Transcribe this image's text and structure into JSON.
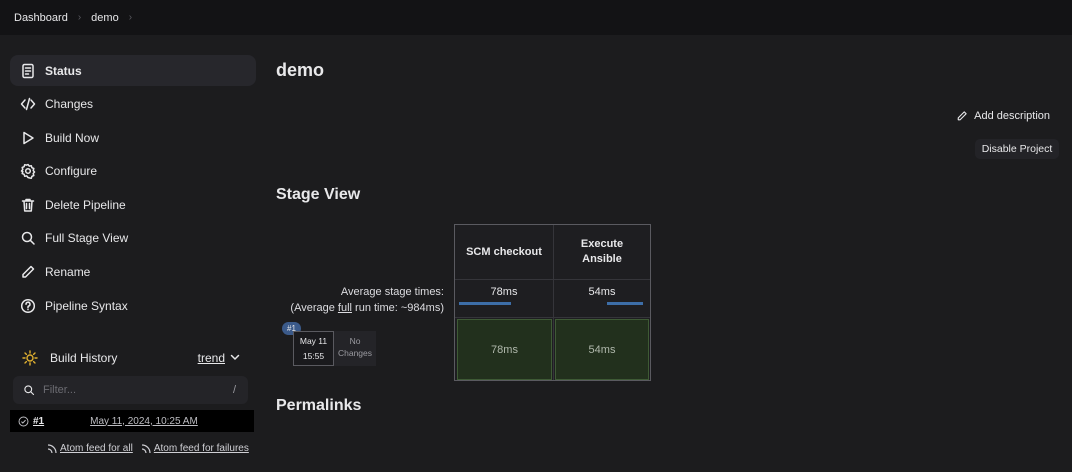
{
  "breadcrumb": {
    "items": [
      "Dashboard",
      "demo"
    ]
  },
  "sidebar": {
    "items": [
      {
        "label": "Status",
        "icon": "status-icon"
      },
      {
        "label": "Changes",
        "icon": "code-icon"
      },
      {
        "label": "Build Now",
        "icon": "play-icon"
      },
      {
        "label": "Configure",
        "icon": "gear-icon"
      },
      {
        "label": "Delete Pipeline",
        "icon": "trash-icon"
      },
      {
        "label": "Full Stage View",
        "icon": "search-icon"
      },
      {
        "label": "Rename",
        "icon": "pencil-icon"
      },
      {
        "label": "Pipeline Syntax",
        "icon": "help-icon"
      }
    ]
  },
  "build_history": {
    "title": "Build History",
    "trend_label": "trend",
    "filter_placeholder": "Filter...",
    "filter_shortcut": "/",
    "builds": [
      {
        "number": "#1",
        "date": "May 11, 2024, 10:25 AM"
      }
    ],
    "feed_all": "Atom feed for all",
    "feed_failures": "Atom feed for failures"
  },
  "main": {
    "title": "demo",
    "add_description": "Add description",
    "disable_project": "Disable Project",
    "stage_view_title": "Stage View",
    "avg_stage_times": "Average stage times:",
    "avg_run_prefix": "(Average ",
    "avg_run_full": "full",
    "avg_run_suffix": " run time: ~984ms)",
    "stages": [
      {
        "name": "SCM checkout",
        "avg": "78ms",
        "avg_fraction": 0.6,
        "result": "78ms"
      },
      {
        "name": "Execute Ansible",
        "avg": "54ms",
        "avg_fraction": 0.42,
        "result": "54ms"
      }
    ],
    "build_row": {
      "badge": "#1",
      "date": "May 11",
      "time": "15:55",
      "changes": "No Changes"
    },
    "permalinks_title": "Permalinks"
  },
  "colors": {
    "background": "#1c1c1e",
    "topbar": "#131315",
    "stage_success": "#22301d",
    "accent_blue": "#3d6ea8"
  }
}
